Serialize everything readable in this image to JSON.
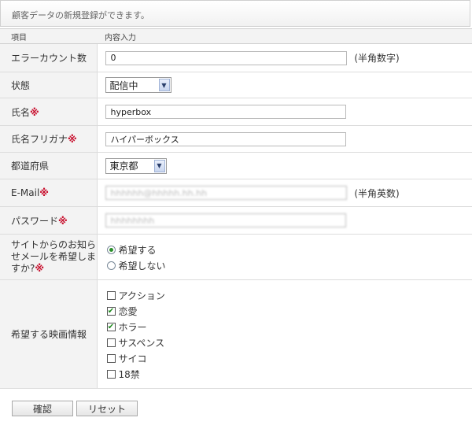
{
  "info_text": "顧客データの新規登録ができます。",
  "header": {
    "item": "項目",
    "content": "内容入力"
  },
  "required_mark": "※",
  "fields": {
    "error_count": {
      "label": "エラーカウント数",
      "value": "0",
      "note": "(半角数字)"
    },
    "status": {
      "label": "状態",
      "selected": "配信中"
    },
    "name": {
      "label": "氏名",
      "value": "hyperbox"
    },
    "name_kana": {
      "label": "氏名フリガナ",
      "value": "ハイパーボックス"
    },
    "prefecture": {
      "label": "都道府県",
      "selected": "東京都"
    },
    "email": {
      "label": "E-Mail",
      "value": "hhhhhh@hhhhh.hh.hh",
      "note": "(半角英数)"
    },
    "password": {
      "label": "パスワード",
      "value": "hhhhhhhh"
    },
    "newsletter": {
      "label": "サイトからのお知らせメールを希望しますか?",
      "options": [
        {
          "label": "希望する",
          "checked": true
        },
        {
          "label": "希望しない",
          "checked": false
        }
      ]
    },
    "movies": {
      "label": "希望する映画情報",
      "options": [
        {
          "label": "アクション",
          "checked": false
        },
        {
          "label": "恋愛",
          "checked": true
        },
        {
          "label": "ホラー",
          "checked": true
        },
        {
          "label": "サスペンス",
          "checked": false
        },
        {
          "label": "サイコ",
          "checked": false
        },
        {
          "label": "18禁",
          "checked": false
        }
      ]
    }
  },
  "buttons": {
    "confirm": "確認",
    "reset": "リセット"
  },
  "colors": {
    "required": "#c8102e",
    "label_bg": "#f3f3f3",
    "check": "#1f8a1f"
  },
  "icons": {
    "select_arrow": "chevron-down-icon",
    "checkmark": "check-icon"
  }
}
